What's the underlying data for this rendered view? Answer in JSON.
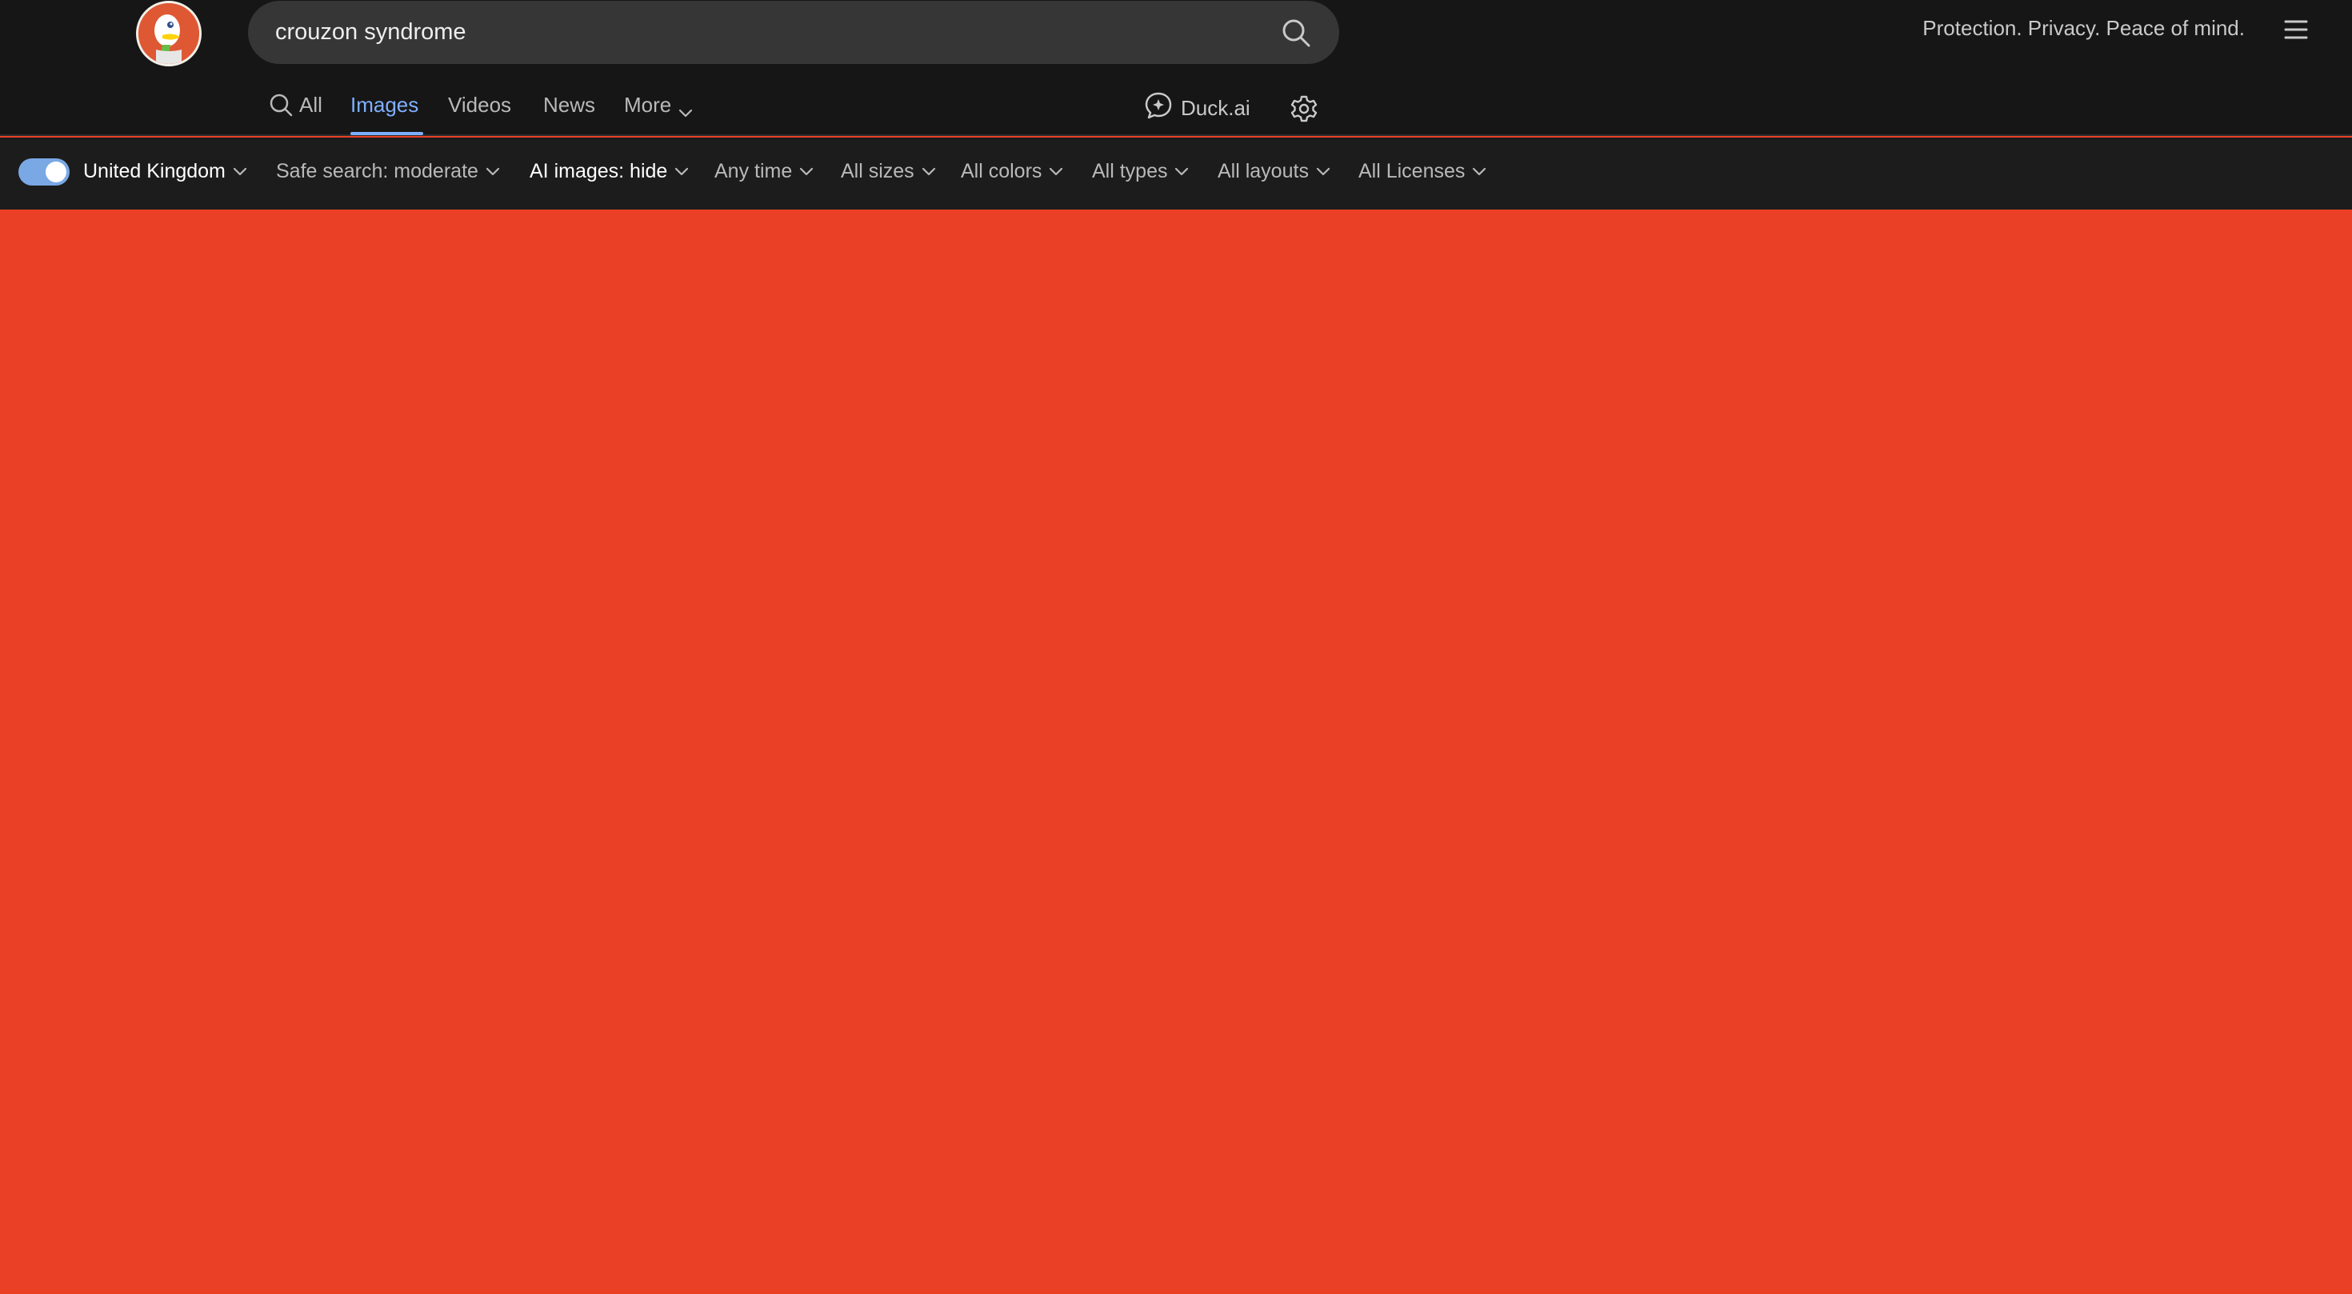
{
  "search": {
    "query": "crouzon syndrome",
    "placeholder": "Search"
  },
  "header": {
    "tagline": "Protection. Privacy. Peace of mind."
  },
  "tabs": [
    {
      "label": "All",
      "icon": "search-icon"
    },
    {
      "label": "Images",
      "active": true
    },
    {
      "label": "Videos"
    },
    {
      "label": "News"
    },
    {
      "label": "More",
      "icon": "chevron-down-icon"
    }
  ],
  "duckai": {
    "label": "Duck.ai",
    "icon": "chat-sparkle-icon"
  },
  "filters": {
    "region": "United Kingdom",
    "safe_search": "Safe search: moderate",
    "ai_images": "AI images: hide",
    "time": "Any time",
    "size": "All sizes",
    "color": "All colors",
    "type": "All types",
    "layout": "All layouts",
    "license": "All Licenses",
    "region_toggle_on": true
  },
  "colors": {
    "header_bg": "#161616",
    "accent": "#7fb0ff",
    "results_bg": "#e94026",
    "brand": "#de5833"
  }
}
